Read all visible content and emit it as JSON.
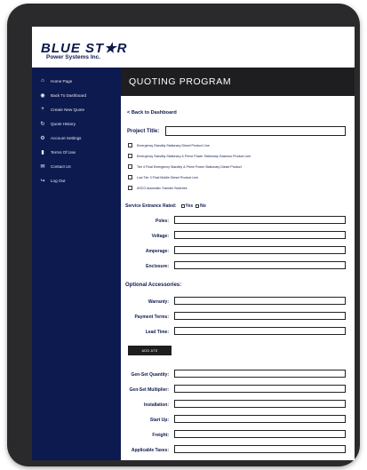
{
  "logo": {
    "name": "BLUE ST★R",
    "subtitle": "Power Systems Inc."
  },
  "sidebar": {
    "items": [
      {
        "label": "Home Page",
        "icon": "home-icon"
      },
      {
        "label": "Back To Dashboard",
        "icon": "dashboard-icon"
      },
      {
        "label": "Create New Quote",
        "icon": "plus-icon"
      },
      {
        "label": "Quote History",
        "icon": "history-icon"
      },
      {
        "label": "Account Settings",
        "icon": "gear-icon"
      },
      {
        "label": "Terms Of Use",
        "icon": "document-icon"
      },
      {
        "label": "Contact Us",
        "icon": "mail-icon"
      },
      {
        "label": "Log Out",
        "icon": "logout-icon"
      }
    ]
  },
  "header": {
    "title": "QUOTING PROGRAM"
  },
  "back_link": {
    "label": "<  Back to Dashboard"
  },
  "project": {
    "title_label": "Project Title:",
    "value": ""
  },
  "product_lines": [
    "Emergency Standby Stationary Diesel Product Line",
    "Emergency Standby Stationary & Prime Power Stationary Gaseous Product Line",
    "Tier 4 Final Emergency Standby & Prime Power Stationary Diesel Product",
    "Low Tier 3 Fluid Mobile Diesel Product Line",
    "ASCO Automatic Transfer Switches"
  ],
  "service_entrance": {
    "label": "Service Entrance Rated:",
    "yes": "Yes",
    "no": "No"
  },
  "fields_a": [
    {
      "label": "Poles:",
      "value": ""
    },
    {
      "label": "Voltage:",
      "value": ""
    },
    {
      "label": "Amperage:",
      "value": ""
    },
    {
      "label": "Enclosure:",
      "value": ""
    }
  ],
  "optional": {
    "title": "Optional Accessories:"
  },
  "fields_b": [
    {
      "label": "Warranty:",
      "value": ""
    },
    {
      "label": "Payment Terms:",
      "value": ""
    },
    {
      "label": "Lead Time:",
      "value": ""
    }
  ],
  "add_button": {
    "label": "ADD ATS"
  },
  "fields_c": [
    {
      "label": "Gen-Set Quantity:",
      "value": ""
    },
    {
      "label": "Gen-Set Multiplier:",
      "value": ""
    },
    {
      "label": "Installation:",
      "value": ""
    },
    {
      "label": "Start Up:",
      "value": ""
    },
    {
      "label": "Freight:",
      "value": ""
    },
    {
      "label": "Applicable Taxes:",
      "value": ""
    }
  ],
  "colors": {
    "navy": "#0d1a4f",
    "dark": "#1e1e20",
    "bezel": "#2a2a2c"
  }
}
